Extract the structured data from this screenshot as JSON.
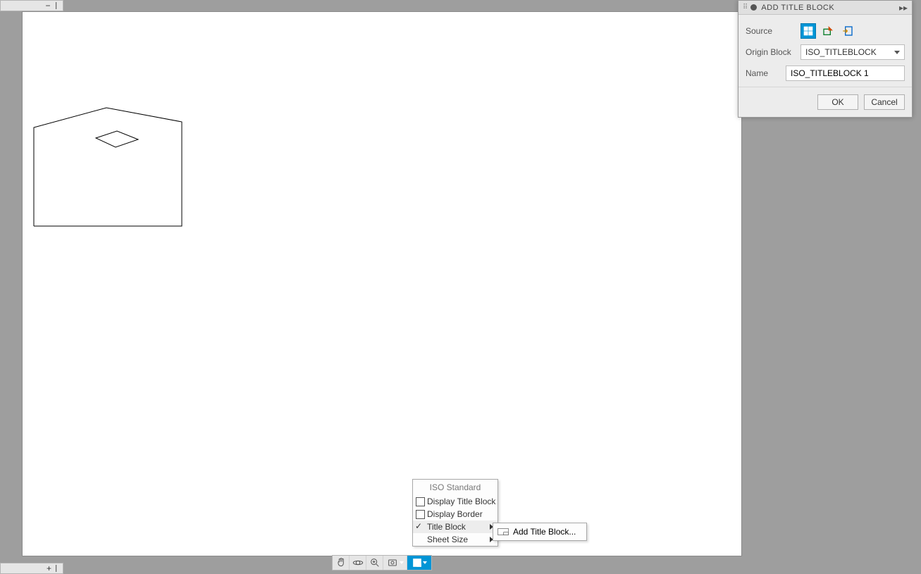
{
  "dialog": {
    "title": "ADD TITLE BLOCK",
    "labels": {
      "source": "Source",
      "origin_block": "Origin Block",
      "name": "Name"
    },
    "origin_block_value": "ISO_TITLEBLOCK",
    "name_value": "ISO_TITLEBLOCK 1",
    "ok": "OK",
    "cancel": "Cancel"
  },
  "context_menu": {
    "header": "ISO Standard",
    "display_title_block": "Display Title Block",
    "display_border": "Display Border",
    "title_block": "Title Block",
    "sheet_size": "Sheet Size",
    "submenu": {
      "add_title_block": "Add Title Block..."
    }
  },
  "toolbar": {
    "pan": "pan-icon",
    "orbit": "orbit-icon",
    "zoom": "zoom-icon",
    "settings": "settings-icon",
    "sheet": "sheet-options-icon"
  }
}
